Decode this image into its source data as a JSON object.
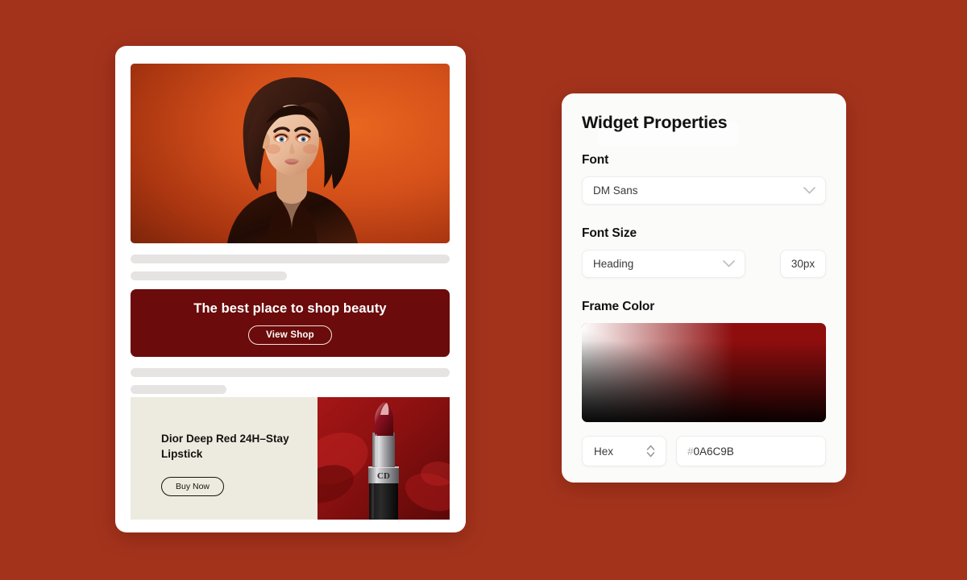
{
  "canvas": {
    "background_color": "#A4331C"
  },
  "preview_card": {
    "hero": {
      "icon": "portrait-photo",
      "alt": "Fashion model portrait on orange gradient background"
    },
    "skeleton_top": [
      "placeholder-line-full",
      "placeholder-line-half"
    ],
    "promo_banner": {
      "background_color": "#6B0B0B",
      "title": "The best place to shop beauty",
      "cta_label": "View Shop"
    },
    "skeleton_bottom": [
      "placeholder-line-full",
      "placeholder-line-third"
    ],
    "product_banner": {
      "background_color": "#EDEBE0",
      "title": "Dior Deep Red 24H–Stay Lipstick",
      "cta_label": "Buy Now",
      "photo_alt": "Dior red lipstick tube on red background"
    }
  },
  "properties_panel": {
    "title": "Widget Properties",
    "font": {
      "label": "Font",
      "value": "DM Sans",
      "icon": "chevron-down-icon"
    },
    "font_size": {
      "label": "Font Size",
      "value": "Heading",
      "icon": "chevron-down-icon",
      "size_value": "30px"
    },
    "frame_color": {
      "label": "Frame Color",
      "swatch_base_color": "#8E0E0E",
      "mode": "Hex",
      "mode_icon": "chevron-updown-stepper-icon",
      "hex_hash": "#",
      "hex_digits": "0A6C9B"
    }
  }
}
